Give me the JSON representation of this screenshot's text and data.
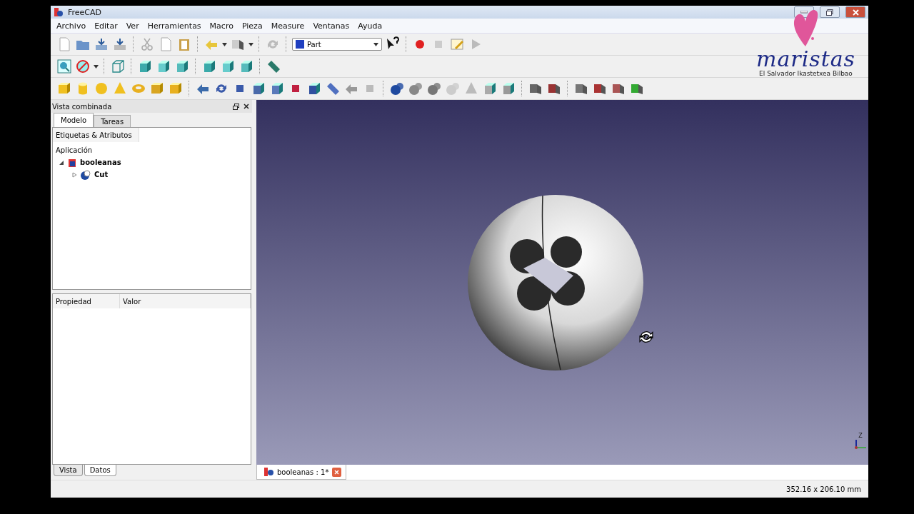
{
  "window": {
    "title": "FreeCAD"
  },
  "overlay_logo": {
    "name": "maristas",
    "subtitle": "El Salvador Ikastetxea Bilbao"
  },
  "menu": [
    "Archivo",
    "Editar",
    "Ver",
    "Herramientas",
    "Macro",
    "Pieza",
    "Measure",
    "Ventanas",
    "Ayuda"
  ],
  "workbench": {
    "value": "Part"
  },
  "combo_view": {
    "title": "Vista combinada",
    "tabs": [
      {
        "label": "Modelo",
        "selected": true
      },
      {
        "label": "Tareas",
        "selected": false
      }
    ],
    "tree_header": "Etiquetas & Atributos",
    "tree": {
      "label": "Aplicación",
      "children": [
        {
          "label": "booleanas",
          "expanded": true,
          "children": [
            {
              "label": "Cut",
              "expanded": false
            }
          ]
        }
      ]
    },
    "property_columns": [
      "Propiedad",
      "Valor"
    ],
    "bottom_tabs": [
      {
        "label": "Vista",
        "selected": false
      },
      {
        "label": "Datos",
        "selected": true
      }
    ]
  },
  "view": {
    "axis_label": "Z"
  },
  "document_tabs": [
    {
      "label": "booleanas : 1*",
      "selected": true
    }
  ],
  "status_bar": {
    "dimensions": "352.16 x 206.10 mm"
  }
}
